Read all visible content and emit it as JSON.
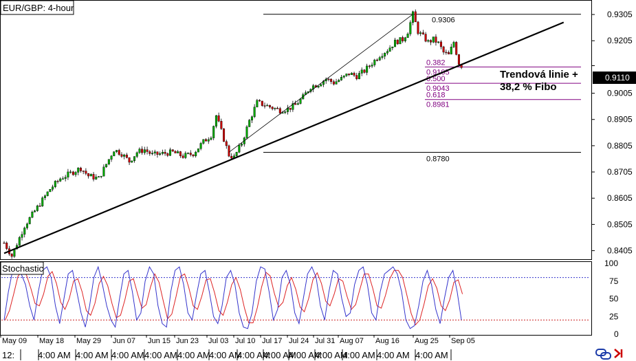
{
  "chart_title": "EUR/GBP: 4-hour",
  "indicator_title": "Stochastic",
  "annotation": {
    "line1": "Trendová linie +",
    "line2": "38,2 % Fibo"
  },
  "current_price": "0.9110",
  "colors": {
    "bull": "#00aa00",
    "bear": "#cc0000",
    "fib": "#800080",
    "stoch_k": "#3333cc",
    "stoch_d": "#dd2222",
    "price_tag": "#000000"
  },
  "chart_data": [
    {
      "type": "candlestick",
      "title": "EUR/GBP: 4-hour",
      "y_ticks": [
        "0.9305",
        "0.9205",
        "0.9110",
        "0.9005",
        "0.8905",
        "0.8805",
        "0.8705",
        "0.8605",
        "0.8505",
        "0.8405"
      ],
      "ylim": [
        0.8375,
        0.9355
      ],
      "x_date_labels": [
        "May 09",
        "May 18",
        "May 29",
        "Jun 07",
        "Jun 15",
        "Jun 23",
        "Jul 03",
        "Jul 10",
        "Jul 17",
        "Jul 24",
        "Jul 31",
        "Aug 07",
        "Aug 16",
        "Aug 25",
        "Sep 05"
      ],
      "x_time_labels": [
        "12:",
        "4:00 AM",
        "4:00 AM",
        "4:00 AM",
        "4:00 AM",
        "4:00 AM",
        "4:00 AM",
        "4:00 AM",
        "4:00 AM",
        "4:00 AM",
        "4:00 AM",
        "4:00 AM",
        "4:00 AM",
        "4:00 AM"
      ],
      "close_path": [
        [
          0,
          0.8435
        ],
        [
          3,
          0.8385
        ],
        [
          8,
          0.85
        ],
        [
          13,
          0.857
        ],
        [
          18,
          0.864
        ],
        [
          22,
          0.868
        ],
        [
          26,
          0.87
        ],
        [
          30,
          0.872
        ],
        [
          33,
          0.869
        ],
        [
          37,
          0.868
        ],
        [
          40,
          0.8735
        ],
        [
          43,
          0.879
        ],
        [
          46,
          0.8775
        ],
        [
          49,
          0.8745
        ],
        [
          52,
          0.878
        ],
        [
          55,
          0.879
        ],
        [
          58,
          0.877
        ],
        [
          62,
          0.8775
        ],
        [
          66,
          0.878
        ],
        [
          70,
          0.8765
        ],
        [
          74,
          0.8775
        ],
        [
          78,
          0.882
        ],
        [
          81,
          0.8845
        ],
        [
          83,
          0.892
        ],
        [
          86,
          0.883
        ],
        [
          88,
          0.877
        ],
        [
          90,
          0.876
        ],
        [
          93,
          0.8815
        ],
        [
          96,
          0.89
        ],
        [
          99,
          0.897
        ],
        [
          102,
          0.896
        ],
        [
          105,
          0.895
        ],
        [
          108,
          0.894
        ],
        [
          111,
          0.8945
        ],
        [
          114,
          0.896
        ],
        [
          117,
          0.899
        ],
        [
          120,
          0.903
        ],
        [
          123,
          0.904
        ],
        [
          126,
          0.906
        ],
        [
          129,
          0.9045
        ],
        [
          132,
          0.906
        ],
        [
          135,
          0.908
        ],
        [
          138,
          0.907
        ],
        [
          141,
          0.909
        ],
        [
          144,
          0.912
        ],
        [
          147,
          0.915
        ],
        [
          150,
          0.917
        ],
        [
          153,
          0.92
        ],
        [
          156,
          0.921
        ],
        [
          158,
          0.924
        ],
        [
          160,
          0.9306
        ],
        [
          162,
          0.924
        ],
        [
          164,
          0.922
        ],
        [
          166,
          0.92
        ],
        [
          168,
          0.921
        ],
        [
          170,
          0.9195
        ],
        [
          172,
          0.916
        ],
        [
          174,
          0.915
        ],
        [
          176,
          0.92
        ],
        [
          178,
          0.912
        ],
        [
          179,
          0.911
        ]
      ],
      "n_candles": 180,
      "trendline": {
        "start": [
          0.0,
          0.8395
        ],
        "end": [
          219,
          0.9275
        ]
      },
      "swing_line": {
        "from": [
          88,
          0.878
        ],
        "to": [
          160,
          0.9306
        ]
      },
      "levels": [
        {
          "price": 0.9306,
          "label": "0.9306",
          "color": "#000000",
          "role": "high"
        },
        {
          "price": 0.9105,
          "label": "0.9105",
          "color": "#800080",
          "fib": "0.382"
        },
        {
          "price": 0.9043,
          "label": "0.9043",
          "color": "#800080",
          "fib": "0.500"
        },
        {
          "price": 0.8981,
          "label": "0.8981",
          "color": "#800080",
          "fib": "0.618"
        },
        {
          "price": 0.878,
          "label": "0.8780",
          "color": "#000000",
          "role": "low"
        }
      ]
    },
    {
      "type": "line",
      "title": "Stochastic",
      "y_ticks": [
        "100",
        "75",
        "50",
        "25",
        "0"
      ],
      "ylim": [
        0,
        100
      ],
      "upper_level": 80,
      "lower_level": 20,
      "k_values": [
        20,
        60,
        90,
        95,
        85,
        70,
        40,
        20,
        60,
        90,
        95,
        80,
        40,
        15,
        50,
        85,
        90,
        60,
        30,
        10,
        40,
        80,
        95,
        70,
        40,
        20,
        10,
        50,
        85,
        90,
        60,
        20,
        30,
        75,
        95,
        85,
        40,
        15,
        10,
        60,
        90,
        95,
        70,
        30,
        20,
        55,
        85,
        90,
        60,
        25,
        15,
        40,
        80,
        90,
        70,
        30,
        10,
        8,
        30,
        75,
        95,
        92,
        60,
        20,
        35,
        80,
        90,
        70,
        30,
        15,
        50,
        85,
        95,
        80,
        40,
        20,
        60,
        90,
        85,
        50,
        25,
        30,
        70,
        90,
        95,
        70,
        30,
        20,
        60,
        85,
        90,
        95,
        85,
        60,
        20,
        8,
        12,
        40,
        75,
        90,
        70,
        35,
        15,
        50,
        80,
        90,
        60,
        20
      ]
    }
  ]
}
